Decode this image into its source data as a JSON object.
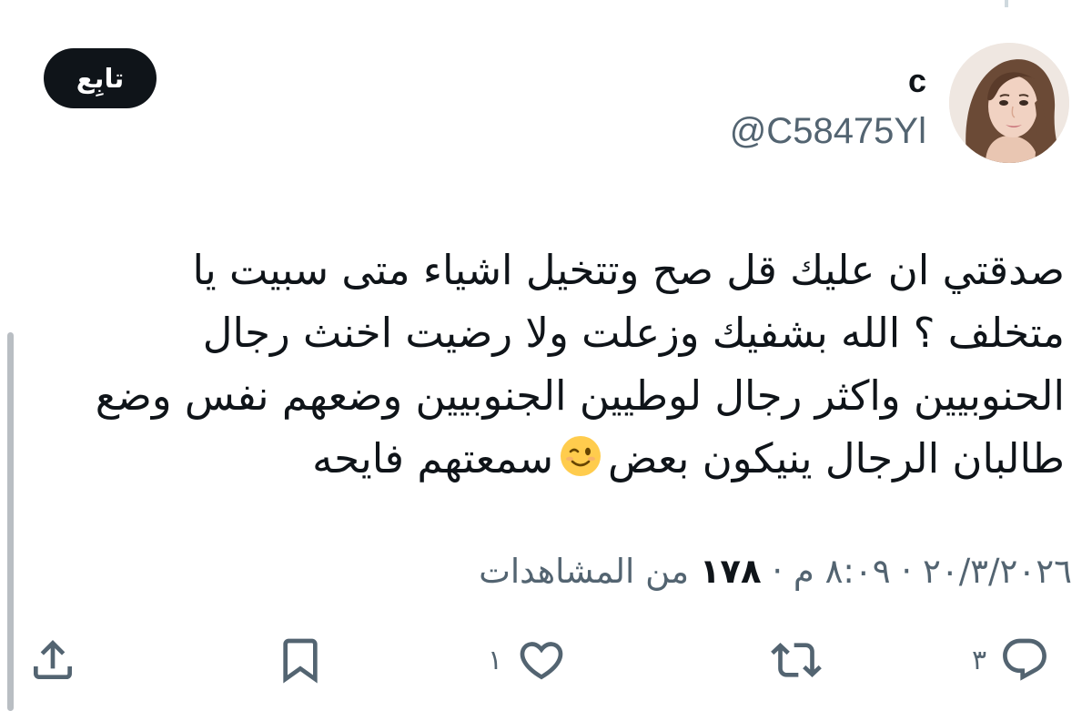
{
  "author": {
    "display_name": "c",
    "handle": "@C58475Yl"
  },
  "follow_button": {
    "label": "تابِع"
  },
  "tweet": {
    "lines": [
      "صدقتي ان عليك قل صح وتتخيل اشياء متى سبيت يا",
      "متخلف ؟ الله بشفيك وزعلت ولا رضيت اخنث رجال",
      "الحنوبيين واكثر رجال لوطيين الجنوبيين وضعهم نفس وضع"
    ],
    "last_line_before_emoji": "طالبان الرجال ينيكون بعض",
    "last_line_after_emoji": "سمعتهم فايحه",
    "emoji": "winking-face-emoji"
  },
  "meta": {
    "time": "٨:٠٩ م",
    "date": "٢٠/٣/٢٠٢٦",
    "separator": "·",
    "views_count": "١٧٨",
    "views_label": "من المشاهدات"
  },
  "actions": {
    "reply": {
      "icon": "reply-icon",
      "count": "٣"
    },
    "repost": {
      "icon": "repost-icon",
      "count": ""
    },
    "like": {
      "icon": "heart-icon",
      "count": "١"
    },
    "bookmark": {
      "icon": "bookmark-icon",
      "count": ""
    },
    "share": {
      "icon": "share-icon",
      "count": ""
    }
  },
  "colors": {
    "text_primary": "#0f1419",
    "text_secondary": "#536471",
    "follow_bg": "#0f1419",
    "follow_text": "#ffffff",
    "thread_line": "#cfd9de"
  }
}
